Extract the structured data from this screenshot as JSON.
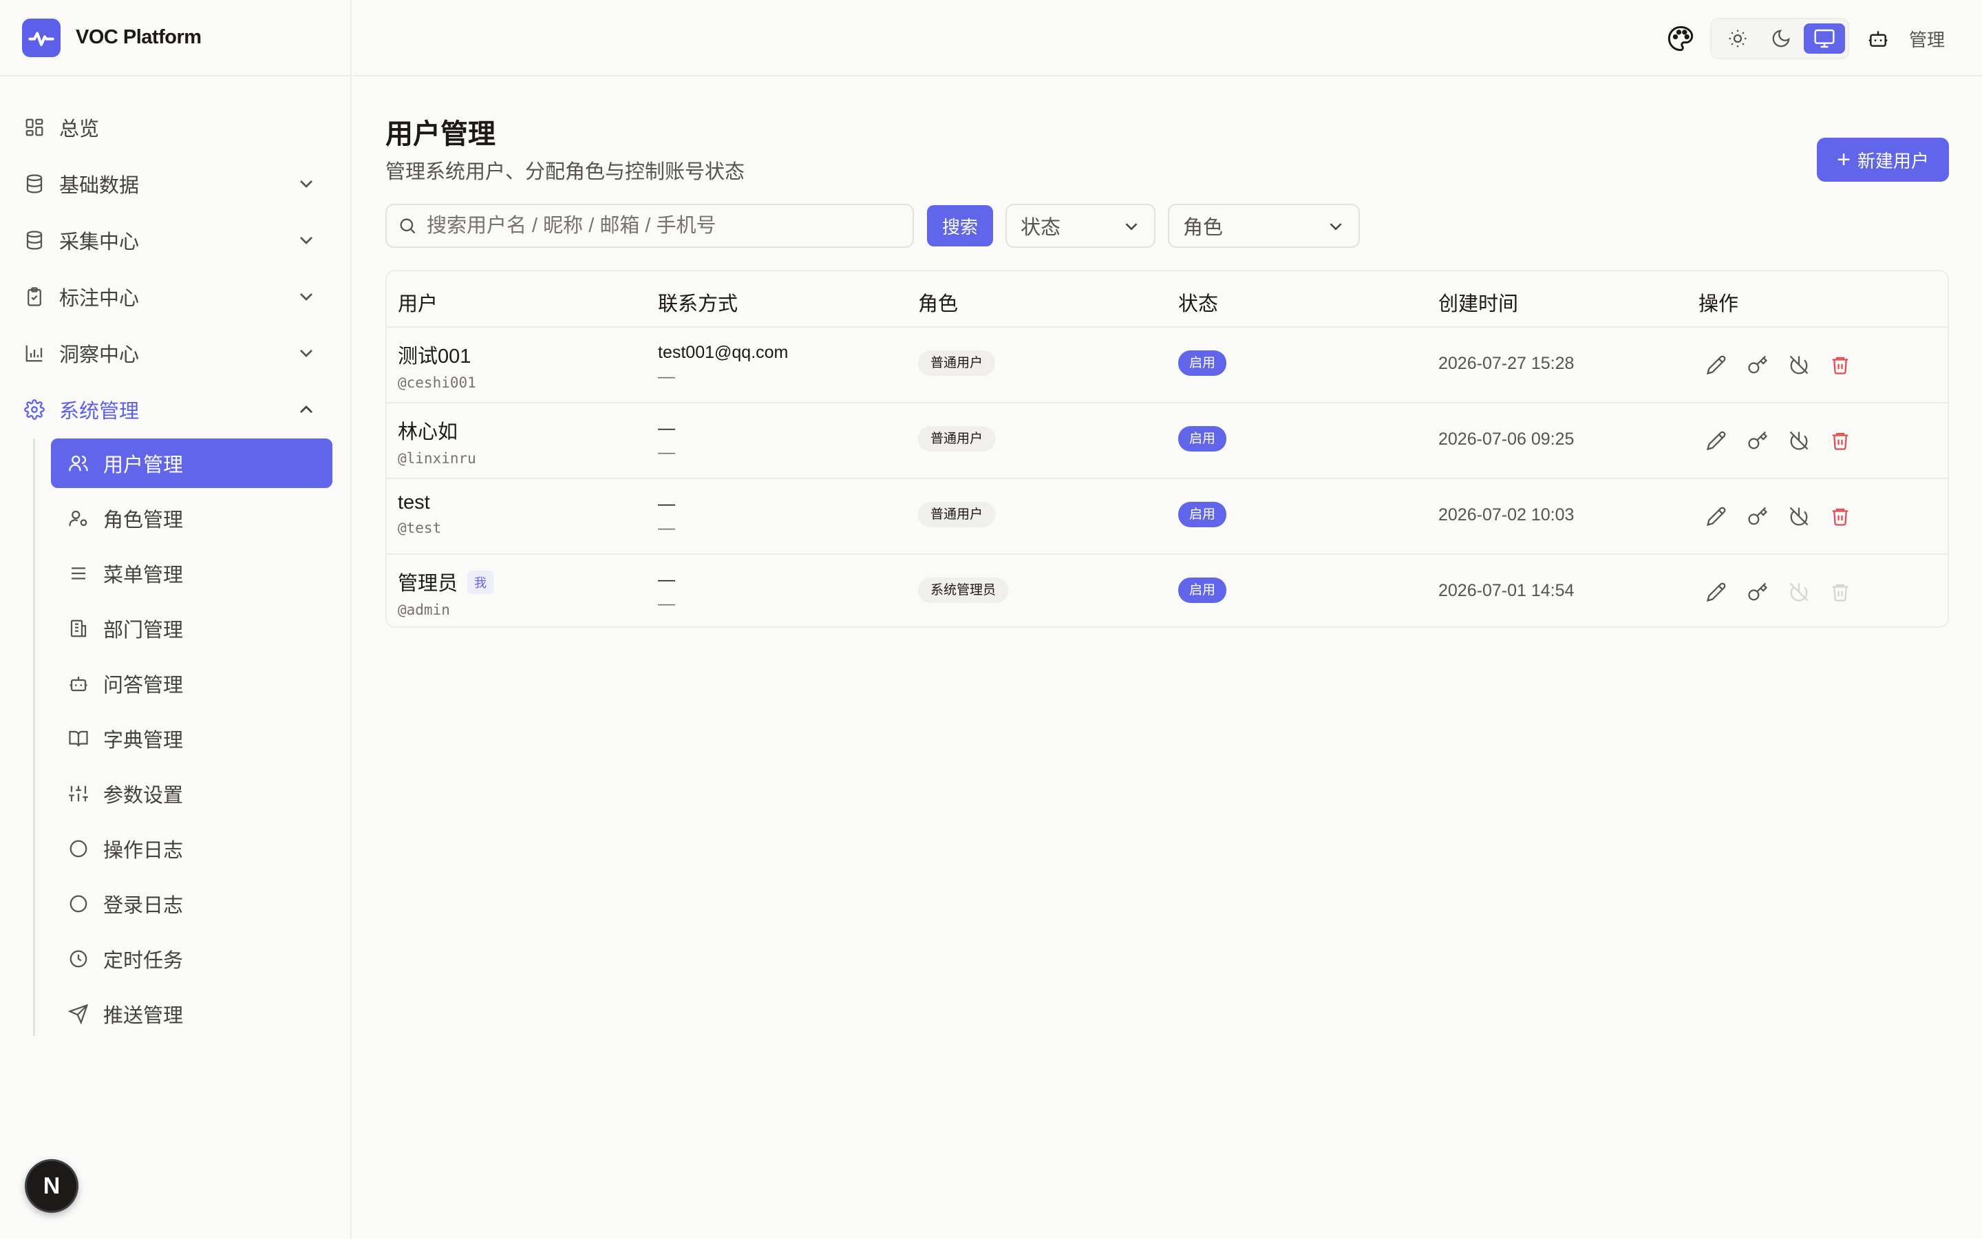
{
  "app": {
    "name": "VOC Platform"
  },
  "sidebar": {
    "items": [
      {
        "label": "总览",
        "icon": "dashboard-icon"
      },
      {
        "label": "基础数据",
        "icon": "database-icon"
      },
      {
        "label": "采集中心",
        "icon": "database-icon"
      },
      {
        "label": "标注中心",
        "icon": "clipboard-check-icon"
      },
      {
        "label": "洞察中心",
        "icon": "bar-chart-icon"
      },
      {
        "label": "系统管理",
        "icon": "gear-icon"
      }
    ],
    "sub_items": [
      {
        "label": "用户管理",
        "icon": "users-icon"
      },
      {
        "label": "角色管理",
        "icon": "user-cog-icon"
      },
      {
        "label": "菜单管理",
        "icon": "menu-icon"
      },
      {
        "label": "部门管理",
        "icon": "building-icon"
      },
      {
        "label": "问答管理",
        "icon": "bot-icon"
      },
      {
        "label": "字典管理",
        "icon": "book-icon"
      },
      {
        "label": "参数设置",
        "icon": "sliders-icon"
      },
      {
        "label": "操作日志",
        "icon": "circle-icon"
      },
      {
        "label": "登录日志",
        "icon": "circle-icon"
      },
      {
        "label": "定时任务",
        "icon": "clock-icon"
      },
      {
        "label": "推送管理",
        "icon": "send-icon"
      }
    ]
  },
  "header": {
    "user_label": "管理"
  },
  "page": {
    "title": "用户管理",
    "subtitle": "管理系统用户、分配角色与控制账号状态",
    "new_button": "新建用户"
  },
  "filters": {
    "search_placeholder": "搜索用户名 / 昵称 / 邮箱 / 手机号",
    "search_button": "搜索",
    "status_select": "状态",
    "role_select": "角色"
  },
  "table": {
    "headers": [
      "用户",
      "联系方式",
      "角色",
      "状态",
      "创建时间",
      "操作"
    ],
    "rows": [
      {
        "name": "测试001",
        "handle": "@ceshi001",
        "me": "",
        "email": "test001@qq.com",
        "phone": "—",
        "role": "普通用户",
        "status": "启用",
        "created": "2026-07-27 15:28",
        "actions_disabled": false
      },
      {
        "name": "林心如",
        "handle": "@linxinru",
        "me": "",
        "email": "—",
        "phone": "—",
        "role": "普通用户",
        "status": "启用",
        "created": "2026-07-06 09:25",
        "actions_disabled": false
      },
      {
        "name": "test",
        "handle": "@test",
        "me": "",
        "email": "—",
        "phone": "—",
        "role": "普通用户",
        "status": "启用",
        "created": "2026-07-02 10:03",
        "actions_disabled": false
      },
      {
        "name": "管理员",
        "handle": "@admin",
        "me": "我",
        "email": "—",
        "phone": "—",
        "role": "系统管理员",
        "status": "启用",
        "created": "2026-07-01 14:54",
        "actions_disabled": true
      }
    ]
  },
  "colors": {
    "accent": "#6065ea",
    "danger": "#e5484d",
    "muted": "#d6d3d1"
  }
}
